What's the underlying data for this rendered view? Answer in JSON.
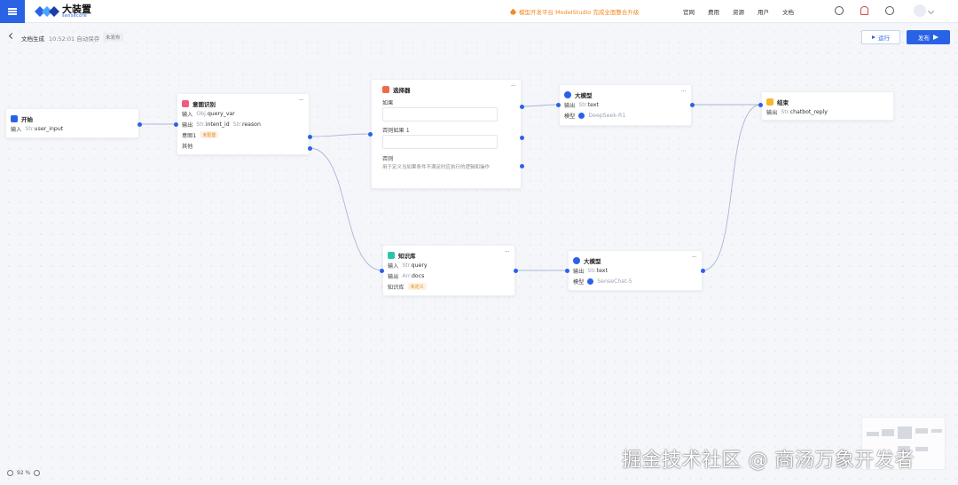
{
  "app": {
    "logo_main": "大装置",
    "logo_sub": "sensecore",
    "announcement": "模型开发平台 ModelStudio 完成全面整合升级",
    "nav": [
      "官网",
      "费用",
      "资源",
      "用户",
      "文档"
    ]
  },
  "doc": {
    "title": "文档生成",
    "saved": "10:52:01 自动保存",
    "status": "未发布"
  },
  "actions": {
    "run": "运行",
    "publish": "发布"
  },
  "nodes": {
    "start": {
      "title": "开始",
      "in_label": "输入",
      "in_type": "Str.",
      "in_var": "user_input"
    },
    "intent": {
      "title": "意图识别",
      "in_label": "输入",
      "in_type": "Obj.",
      "in_var": "query_var",
      "out_label": "输出",
      "out_type1": "Str.",
      "out_var1": "intent_id",
      "out_type2": "Str.",
      "out_var2": "reason",
      "intent1": "意图1",
      "unconfigured": "未配置",
      "other": "其他"
    },
    "selector": {
      "title": "选择器",
      "if": "如果",
      "elseif": "否则如果 1",
      "else": "否则",
      "hint": "用于定义当如果条件不满足时应执行的逻辑和操作"
    },
    "llm1": {
      "title": "大模型",
      "out_label": "输出",
      "out_type": "Str.",
      "out_var": "text",
      "model_label": "模型",
      "model": "DeepSeek-R1"
    },
    "end": {
      "title": "结束",
      "out_label": "输出",
      "out_type": "Str.",
      "out_var": "chatbot_reply"
    },
    "kb": {
      "title": "知识库",
      "in_label": "输入",
      "in_type": "Str.",
      "in_var": "query",
      "out_label": "输出",
      "out_type": "Arr.",
      "out_var": "docs",
      "kb_label": "知识库",
      "undefined": "未定义"
    },
    "llm2": {
      "title": "大模型",
      "out_label": "输出",
      "out_type": "Str.",
      "out_var": "text",
      "model_label": "模型",
      "model": "SenseChat-5"
    }
  },
  "zoom": "92 %",
  "watermark": "掘金技术社区 @ 商汤万象开发者",
  "colors": {
    "accent": "#2a62e6",
    "warning": "#e48a1f",
    "announce": "#f08a24"
  }
}
